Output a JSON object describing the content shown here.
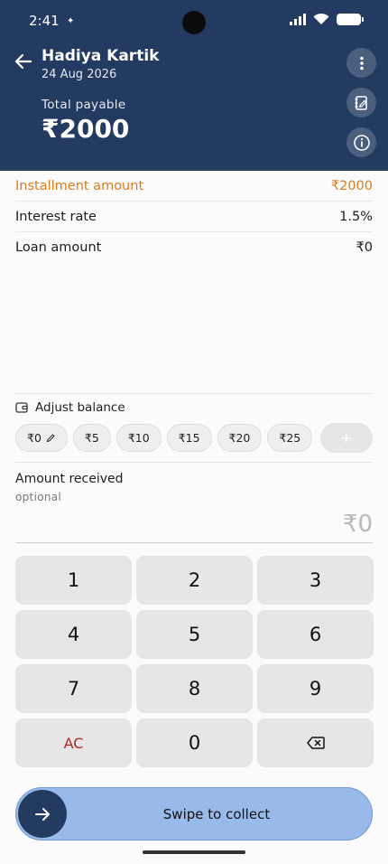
{
  "status_bar": {
    "time": "2:41"
  },
  "header": {
    "customer_name": "Hadiya Kartik",
    "date": "24 Aug 2026",
    "total_label": "Total payable",
    "total_value": "₹2000"
  },
  "summary": {
    "installment_label": "Installment amount",
    "installment_value": "₹2000",
    "interest_label": "Interest rate",
    "interest_value": "1.5%",
    "loan_label": "Loan amount",
    "loan_value": "₹0"
  },
  "adjust": {
    "label": "Adjust balance",
    "chips": [
      "₹0",
      "₹5",
      "₹10",
      "₹15",
      "₹20",
      "₹25"
    ],
    "add_label": "+"
  },
  "amount": {
    "label": "Amount received",
    "hint": "optional",
    "value": "₹0"
  },
  "keypad": [
    "1",
    "2",
    "3",
    "4",
    "5",
    "6",
    "7",
    "8",
    "9",
    "AC",
    "0",
    ""
  ],
  "swipe": {
    "label": "Swipe to collect"
  },
  "colors": {
    "header_bg": "#233b61",
    "accent": "#dc7a1e",
    "swipe_bg": "#97baea",
    "clear_key": "#b3261e"
  }
}
